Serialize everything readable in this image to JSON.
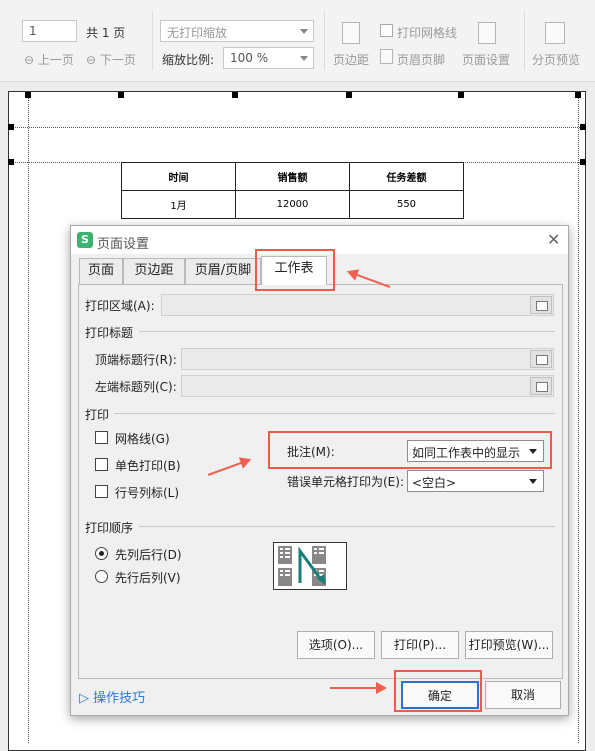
{
  "toolbar": {
    "page_value": "1",
    "page_total": "共 1 页",
    "prev": "上一页",
    "next": "下一页",
    "scale_mode": "无打印缩放",
    "zoom_label": "缩放比例:",
    "zoom_value": "100 %",
    "margins": "页边距",
    "print_grid": "打印网格线",
    "header_footer": "页眉页脚",
    "page_setup": "页面设置",
    "page_break_preview": "分页预览"
  },
  "sheet": {
    "headers": [
      "时间",
      "销售额",
      "任务差额"
    ],
    "rows": [
      [
        "1月",
        "12000",
        "550"
      ]
    ]
  },
  "dialog": {
    "title": "页面设置",
    "tabs": [
      "页面",
      "页边距",
      "页眉/页脚",
      "工作表"
    ],
    "print_area_label": "打印区域(A):",
    "print_titles_group": "打印标题",
    "top_rows_label": "顶端标题行(R):",
    "left_cols_label": "左端标题列(C):",
    "print_group": "打印",
    "gridlines": "网格线(G)",
    "mono": "单色打印(B)",
    "row_col_headers": "行号列标(L)",
    "comments_label": "批注(M):",
    "comments_value": "如同工作表中的显示",
    "errors_label": "错误单元格打印为(E):",
    "errors_value": "<空白>",
    "order_group": "打印顺序",
    "down_then_over": "先列后行(D)",
    "over_then_down": "先行后列(V)",
    "options_btn": "选项(O)...",
    "print_btn": "打印(P)...",
    "preview_btn": "打印预览(W)...",
    "tips": "操作技巧",
    "ok": "确定",
    "cancel": "取消"
  },
  "colors": {
    "highlight": "#f05a4a",
    "accent": "#3cb371",
    "link": "#2a7ad6"
  }
}
